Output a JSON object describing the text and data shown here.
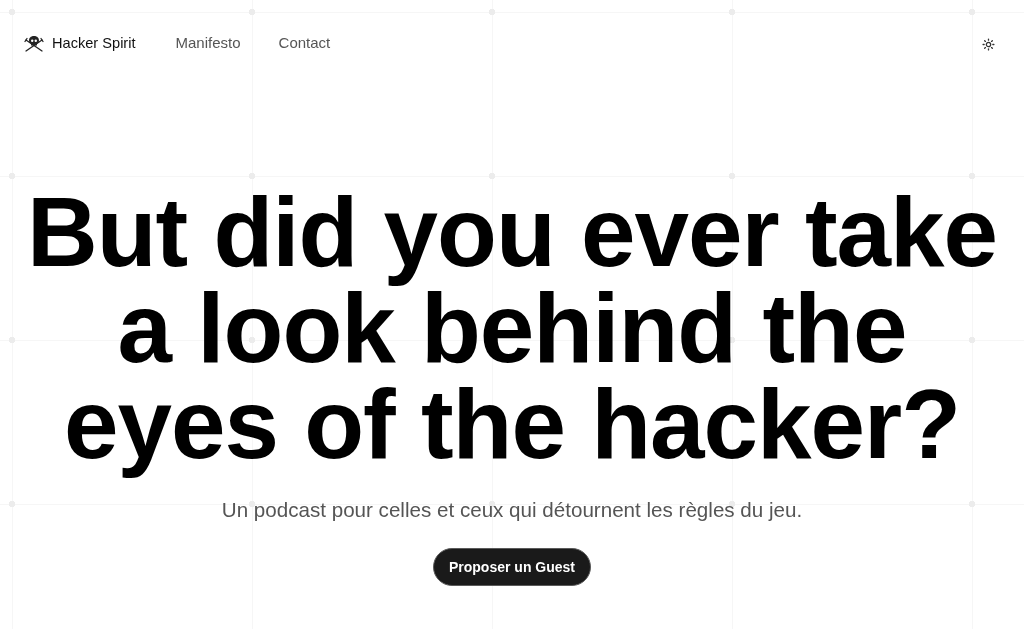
{
  "header": {
    "brand": "Hacker Spirit",
    "nav": [
      {
        "label": "Manifesto"
      },
      {
        "label": "Contact"
      }
    ]
  },
  "hero": {
    "headline": "But did you ever take a look behind the eyes of the hacker?",
    "subtitle": "Un podcast pour celles et ceux qui détournent les règles du jeu.",
    "button": "Proposer un Guest"
  }
}
